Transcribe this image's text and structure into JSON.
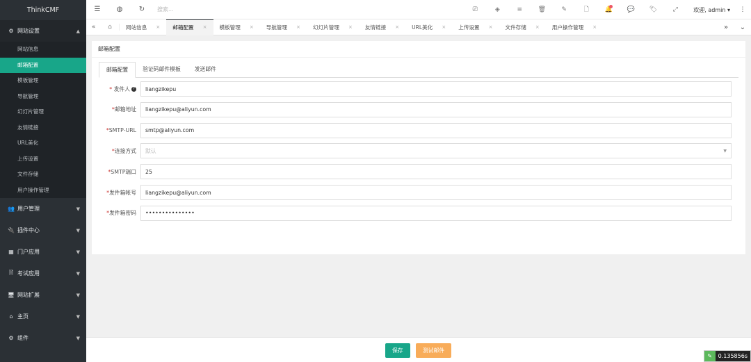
{
  "brand": "ThinkCMF",
  "sidebar": {
    "open_group": {
      "label": "网站设置",
      "icon": "gears-icon"
    },
    "sub_items": [
      {
        "label": "网站信息",
        "active": false
      },
      {
        "label": "邮箱配置",
        "active": true
      },
      {
        "label": "模板管理",
        "active": false
      },
      {
        "label": "导航管理",
        "active": false
      },
      {
        "label": "幻灯片管理",
        "active": false
      },
      {
        "label": "友情链接",
        "active": false
      },
      {
        "label": "URL美化",
        "active": false
      },
      {
        "label": "上传设置",
        "active": false
      },
      {
        "label": "文件存储",
        "active": false
      },
      {
        "label": "用户操作管理",
        "active": false
      }
    ],
    "groups": [
      {
        "label": "用户管理",
        "icon": "users-icon",
        "glyph": "👥"
      },
      {
        "label": "插件中心",
        "icon": "plug-icon",
        "glyph": "🔌"
      },
      {
        "label": "门户应用",
        "icon": "grid-icon",
        "glyph": "▦"
      },
      {
        "label": "考试应用",
        "icon": "file-icon",
        "glyph": "🗎"
      },
      {
        "label": "网站扩展",
        "icon": "desktop-icon",
        "glyph": "🖥"
      },
      {
        "label": "主页",
        "icon": "home-icon",
        "glyph": "⌂"
      },
      {
        "label": "组件",
        "icon": "gear-icon",
        "glyph": "⚙"
      }
    ]
  },
  "topbar": {
    "search_placeholder": "搜索...",
    "welcome": "欢迎, admin ▾"
  },
  "tabs": [
    {
      "label": "网站信息",
      "active": false
    },
    {
      "label": "邮箱配置",
      "active": true
    },
    {
      "label": "模板管理",
      "active": false
    },
    {
      "label": "导航管理",
      "active": false
    },
    {
      "label": "幻灯片管理",
      "active": false
    },
    {
      "label": "友情链接",
      "active": false
    },
    {
      "label": "URL美化",
      "active": false
    },
    {
      "label": "上传设置",
      "active": false
    },
    {
      "label": "文件存储",
      "active": false
    },
    {
      "label": "用户操作管理",
      "active": false
    }
  ],
  "panel": {
    "title": "邮箱配置",
    "inner_tabs": [
      {
        "label": "邮箱配置",
        "active": true
      },
      {
        "label": "验证码邮件模板",
        "active": false
      },
      {
        "label": "发送邮件",
        "active": false
      }
    ],
    "fields": [
      {
        "required_mark": "* ",
        "label": "发件人",
        "help": true,
        "value": "liangzikepu",
        "type": "text"
      },
      {
        "required_mark": "*",
        "label": "邮箱地址",
        "help": false,
        "value": "liangzikepu@aliyun.com",
        "type": "text"
      },
      {
        "required_mark": "*",
        "label": "SMTP-URL",
        "help": false,
        "value": "smtp@aliyun.com",
        "type": "text"
      },
      {
        "required_mark": "*",
        "label": "连接方式",
        "help": false,
        "value": "默认",
        "type": "select"
      },
      {
        "required_mark": "*",
        "label": "SMTP端口",
        "help": false,
        "value": "25",
        "type": "text"
      },
      {
        "required_mark": "*",
        "label": "发件箱帐号",
        "help": false,
        "value": "liangzikepu@aliyun.com",
        "type": "text"
      },
      {
        "required_mark": "*",
        "label": "发件箱密码",
        "help": false,
        "value": "•••••••••••••••",
        "type": "password"
      }
    ]
  },
  "footer": {
    "save_label": "保存",
    "test_label": "测试邮件"
  },
  "timer": "0.135856s",
  "colors": {
    "accent": "#18a689",
    "warning": "#f8ac59",
    "sidebar": "#2b3035"
  }
}
